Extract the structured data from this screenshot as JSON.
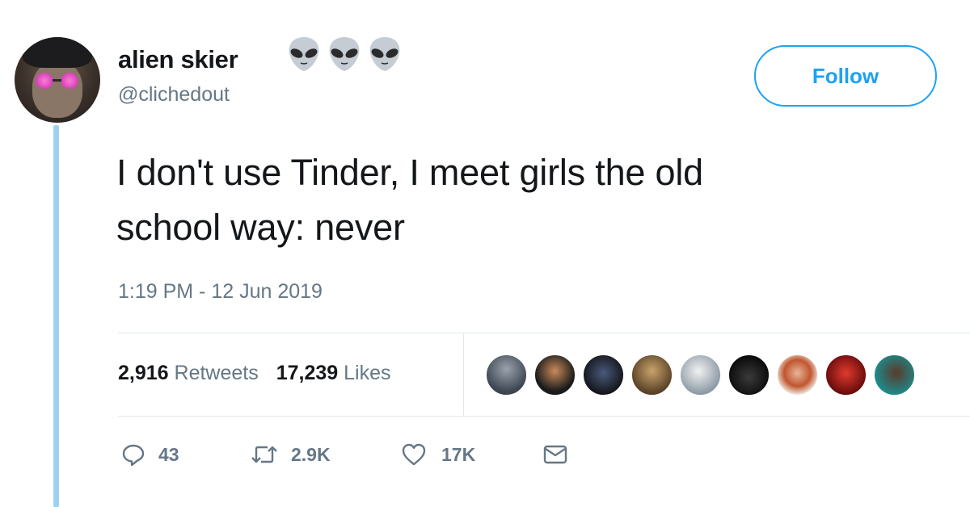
{
  "user": {
    "display_name": "alien skier",
    "handle": "@clichedout",
    "name_emojis": [
      "alien-emoji",
      "alien-emoji",
      "alien-emoji"
    ]
  },
  "follow_label": "Follow",
  "tweet": {
    "line1": "I don't use Tinder, I meet girls the old",
    "line2": "school way: never",
    "timestamp": "1:19 PM - 12 Jun 2019"
  },
  "stats": {
    "retweets_count": "2,916",
    "retweets_label": "Retweets",
    "likes_count": "17,239",
    "likes_label": "Likes"
  },
  "liked_by_avatars": 9,
  "actions": {
    "replies": "43",
    "retweets": "2.9K",
    "likes": "17K"
  },
  "colors": {
    "accent": "#1da1f2",
    "secondary_text": "#657786",
    "thread_line": "#9fd1f3",
    "divider": "#e1e8ed"
  }
}
